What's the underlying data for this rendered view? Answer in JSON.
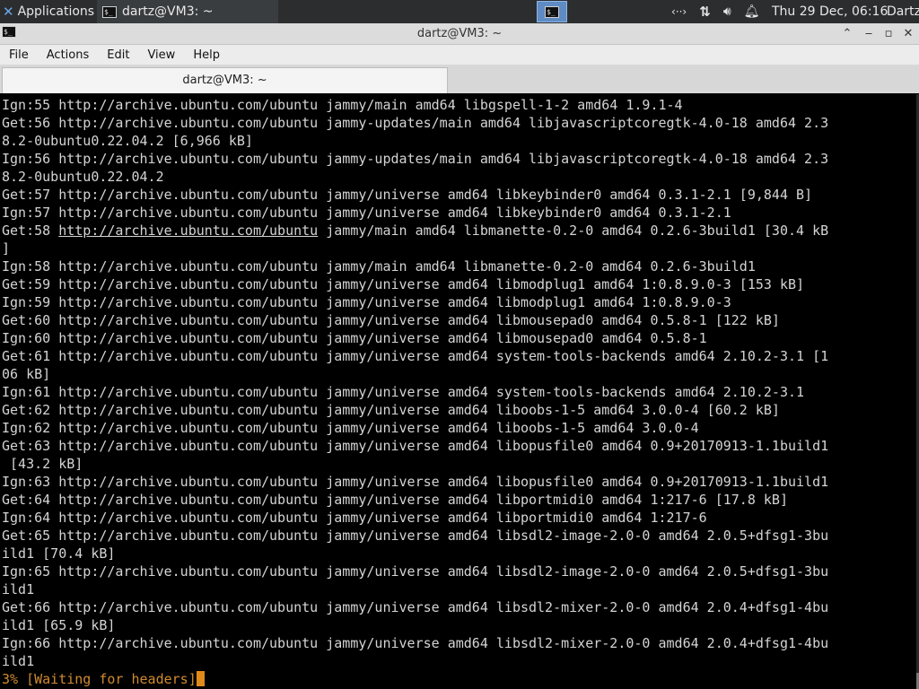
{
  "panel": {
    "apps_label": "Applications",
    "task_label": "dartz@VM3: ~",
    "clock": "Thu 29 Dec, 06:16",
    "user": "Dartz"
  },
  "window": {
    "title": "dartz@VM3: ~",
    "menu": [
      "File",
      "Actions",
      "Edit",
      "View",
      "Help"
    ],
    "tab_label": "dartz@VM3: ~"
  },
  "terminal": {
    "lines": [
      "Ign:55 http://archive.ubuntu.com/ubuntu jammy/main amd64 libgspell-1-2 amd64 1.9.1-4",
      "Get:56 http://archive.ubuntu.com/ubuntu jammy-updates/main amd64 libjavascriptcoregtk-4.0-18 amd64 2.3",
      "8.2-0ubuntu0.22.04.2 [6,966 kB]",
      "Ign:56 http://archive.ubuntu.com/ubuntu jammy-updates/main amd64 libjavascriptcoregtk-4.0-18 amd64 2.3",
      "8.2-0ubuntu0.22.04.2",
      "Get:57 http://archive.ubuntu.com/ubuntu jammy/universe amd64 libkeybinder0 amd64 0.3.1-2.1 [9,844 B]",
      "Ign:57 http://archive.ubuntu.com/ubuntu jammy/universe amd64 libkeybinder0 amd64 0.3.1-2.1",
      "Get:58 http://archive.ubuntu.com/ubuntu jammy/main amd64 libmanette-0.2-0 amd64 0.2.6-3build1 [30.4 kB",
      "]",
      "Ign:58 http://archive.ubuntu.com/ubuntu jammy/main amd64 libmanette-0.2-0 amd64 0.2.6-3build1",
      "Get:59 http://archive.ubuntu.com/ubuntu jammy/universe amd64 libmodplug1 amd64 1:0.8.9.0-3 [153 kB]",
      "Ign:59 http://archive.ubuntu.com/ubuntu jammy/universe amd64 libmodplug1 amd64 1:0.8.9.0-3",
      "Get:60 http://archive.ubuntu.com/ubuntu jammy/universe amd64 libmousepad0 amd64 0.5.8-1 [122 kB]",
      "Ign:60 http://archive.ubuntu.com/ubuntu jammy/universe amd64 libmousepad0 amd64 0.5.8-1",
      "Get:61 http://archive.ubuntu.com/ubuntu jammy/universe amd64 system-tools-backends amd64 2.10.2-3.1 [1",
      "06 kB]",
      "Ign:61 http://archive.ubuntu.com/ubuntu jammy/universe amd64 system-tools-backends amd64 2.10.2-3.1",
      "Get:62 http://archive.ubuntu.com/ubuntu jammy/universe amd64 liboobs-1-5 amd64 3.0.0-4 [60.2 kB]",
      "Ign:62 http://archive.ubuntu.com/ubuntu jammy/universe amd64 liboobs-1-5 amd64 3.0.0-4",
      "Get:63 http://archive.ubuntu.com/ubuntu jammy/universe amd64 libopusfile0 amd64 0.9+20170913-1.1build1",
      " [43.2 kB]",
      "Ign:63 http://archive.ubuntu.com/ubuntu jammy/universe amd64 libopusfile0 amd64 0.9+20170913-1.1build1",
      "Get:64 http://archive.ubuntu.com/ubuntu jammy/universe amd64 libportmidi0 amd64 1:217-6 [17.8 kB]",
      "Ign:64 http://archive.ubuntu.com/ubuntu jammy/universe amd64 libportmidi0 amd64 1:217-6",
      "Get:65 http://archive.ubuntu.com/ubuntu jammy/universe amd64 libsdl2-image-2.0-0 amd64 2.0.5+dfsg1-3bu",
      "ild1 [70.4 kB]",
      "Ign:65 http://archive.ubuntu.com/ubuntu jammy/universe amd64 libsdl2-image-2.0-0 amd64 2.0.5+dfsg1-3bu",
      "ild1",
      "Get:66 http://archive.ubuntu.com/ubuntu jammy/universe amd64 libsdl2-mixer-2.0-0 amd64 2.0.4+dfsg1-4bu",
      "ild1 [65.9 kB]",
      "Ign:66 http://archive.ubuntu.com/ubuntu jammy/universe amd64 libsdl2-mixer-2.0-0 amd64 2.0.4+dfsg1-4bu",
      "ild1"
    ],
    "hover_link": {
      "line": 7,
      "prefix": "Get:58 ",
      "url": "http://archive.ubuntu.com/ubuntu",
      "suffix": " jammy/main amd64 libmanette-0.2-0 amd64 0.2.6-3build1 [30.4 kB"
    },
    "status": "3% [Waiting for headers]"
  },
  "colors": {
    "terminal_bg": "#000000",
    "terminal_fg": "#d4d4d4",
    "status_fg": "#d08a2e",
    "panel_bg": "#2b2d2f",
    "active_task": "#5f8bc4"
  }
}
